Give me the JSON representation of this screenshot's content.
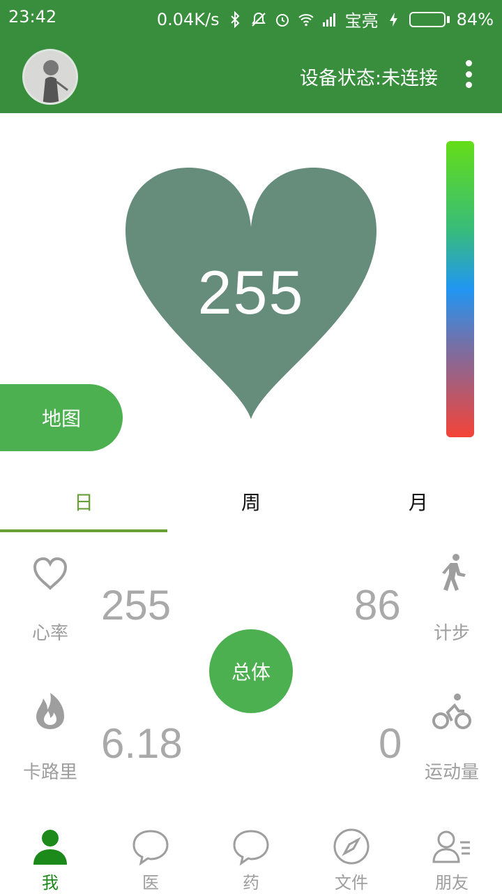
{
  "status_bar": {
    "time": "23:42",
    "speed": "0.04K/s",
    "carrier": "宝亮",
    "battery": "84%",
    "battery_level": 0.84,
    "icons": [
      "bluetooth-icon",
      "mute-icon",
      "alarm-icon",
      "wifi-icon",
      "signal-icon",
      "charging-icon",
      "battery-icon"
    ]
  },
  "app_bar": {
    "device_status": "设备状态:未连接",
    "menu_icon": "more-vert-icon"
  },
  "heart": {
    "value": "255",
    "color": "#668c7c"
  },
  "color_scale": {
    "colors": [
      "#64dd17",
      "#38bc7a",
      "#2196f3",
      "#7a6ea3",
      "#f44336"
    ]
  },
  "map_button": {
    "label": "地图"
  },
  "tabs": [
    {
      "label": "日",
      "active": true
    },
    {
      "label": "周",
      "active": false
    },
    {
      "label": "月",
      "active": false
    }
  ],
  "stats": {
    "heart_rate": {
      "label": "心率",
      "value": "255",
      "icon": "heart-outline-icon"
    },
    "steps": {
      "label": "计步",
      "value": "86",
      "icon": "walking-icon"
    },
    "calories": {
      "label": "卡路里",
      "value": "6.18",
      "icon": "flame-icon"
    },
    "activity": {
      "label": "运动量",
      "value": "0",
      "icon": "cycling-icon"
    }
  },
  "total_button": {
    "label": "总体"
  },
  "bottom_nav": [
    {
      "label": "我",
      "icon": "person-icon",
      "active": true
    },
    {
      "label": "医",
      "icon": "chat-bubble-icon",
      "active": false
    },
    {
      "label": "药",
      "icon": "chat-bubble-icon",
      "active": false
    },
    {
      "label": "文件",
      "icon": "compass-icon",
      "active": false
    },
    {
      "label": "朋友",
      "icon": "contacts-icon",
      "active": false
    }
  ],
  "colors": {
    "primary": "#388e3c",
    "accent": "#4caf50",
    "tab_active": "#689f38",
    "stat_text": "#a9a9a9"
  }
}
